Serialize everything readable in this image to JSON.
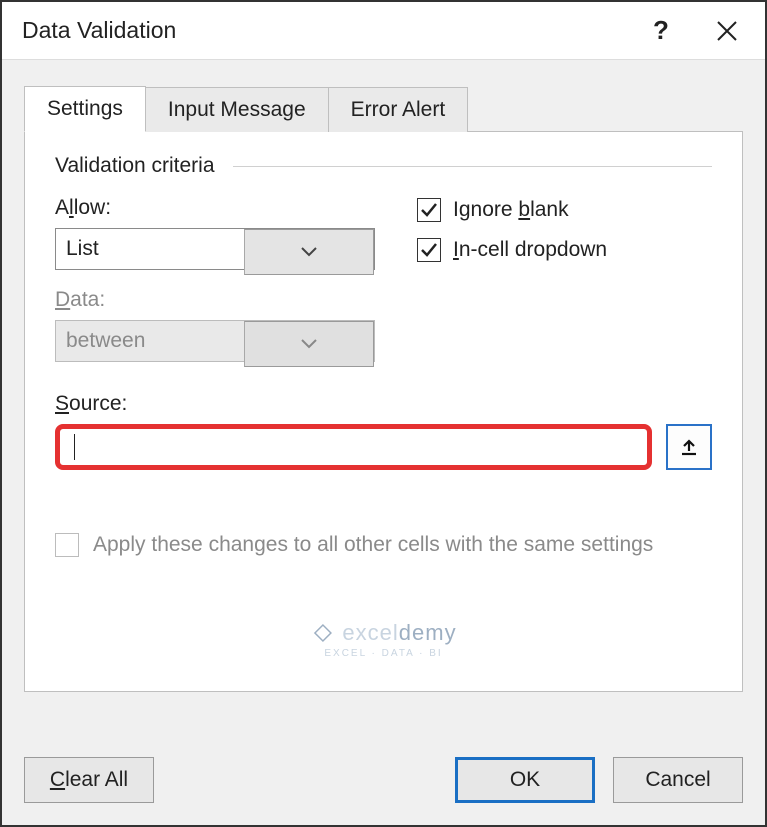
{
  "dialog": {
    "title": "Data Validation"
  },
  "tabs": [
    {
      "label": "Settings",
      "active": true
    },
    {
      "label": "Input Message",
      "active": false
    },
    {
      "label": "Error Alert",
      "active": false
    }
  ],
  "fieldset": {
    "legend": "Validation criteria",
    "allow": {
      "label_pre": "A",
      "label_u": "l",
      "label_post": "low:",
      "value": "List"
    },
    "data": {
      "label_pre": "",
      "label_u": "D",
      "label_post": "ata:",
      "value": "between",
      "enabled": false
    },
    "source": {
      "label_pre": "",
      "label_u": "S",
      "label_post": "ource:",
      "value": ""
    }
  },
  "checks": {
    "ignore_blank": {
      "pre": "Ignore ",
      "u": "b",
      "post": "lank",
      "checked": true
    },
    "incell": {
      "pre": "",
      "u": "I",
      "post": "n-cell dropdown",
      "checked": true
    },
    "apply_same": {
      "pre": "Apply these changes to all other cells with the same settings",
      "checked": false,
      "enabled": false
    }
  },
  "footer": {
    "clear_pre": "",
    "clear_u": "C",
    "clear_post": "lear All",
    "ok": "OK",
    "cancel": "Cancel"
  },
  "watermark": {
    "brand_pre": "excel",
    "brand_post": "demy",
    "sub": "EXCEL · DATA · BI"
  }
}
